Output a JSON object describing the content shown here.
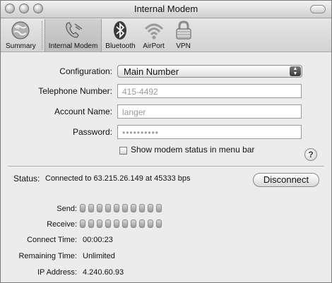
{
  "window": {
    "title": "Internal Modem"
  },
  "toolbar": {
    "items": [
      {
        "label": "Summary",
        "icon": "globe-icon"
      },
      {
        "label": "Internal Modem",
        "icon": "phone-icon",
        "selected": true
      },
      {
        "label": "Bluetooth",
        "icon": "bluetooth-icon"
      },
      {
        "label": "AirPort",
        "icon": "airport-icon"
      },
      {
        "label": "VPN",
        "icon": "lock-icon"
      }
    ]
  },
  "form": {
    "configuration_label": "Configuration:",
    "configuration_value": "Main Number",
    "telephone_label": "Telephone Number:",
    "telephone_value": "415-4492",
    "account_label": "Account Name:",
    "account_value": "langer",
    "password_label": "Password:",
    "password_value": "••••••••••",
    "show_status_label": "Show modem status in menu bar",
    "help_label": "?"
  },
  "status": {
    "label": "Status:",
    "text": "Connected to 63.215.26.149 at 45333 bps",
    "button_label": "Disconnect",
    "send_label": "Send:",
    "receive_label": "Receive:",
    "led_count": 10,
    "connect_time_label": "Connect Time:",
    "connect_time_value": "00:00:23",
    "remaining_time_label": "Remaining Time:",
    "remaining_time_value": "Unlimited",
    "ip_label": "IP Address:",
    "ip_value": "4.240.60.93"
  }
}
